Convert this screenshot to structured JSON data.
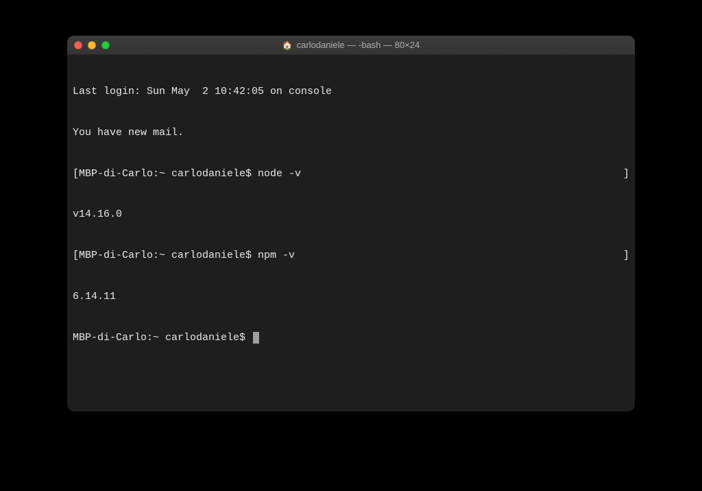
{
  "window": {
    "title": "carlodaniele — -bash — 80×24",
    "icon": "🏠"
  },
  "terminal": {
    "line1": "Last login: Sun May  2 10:42:05 on console",
    "line2": "You have new mail.",
    "prompt1_prefix": "[MBP-di-Carlo:~ carlodaniele$ ",
    "cmd1": "node -v",
    "prompt1_suffix": "]",
    "out1": "v14.16.0",
    "prompt2_prefix": "[MBP-di-Carlo:~ carlodaniele$ ",
    "cmd2": "npm -v",
    "prompt2_suffix": "]",
    "out2": "6.14.11",
    "prompt3": "MBP-di-Carlo:~ carlodaniele$ "
  }
}
